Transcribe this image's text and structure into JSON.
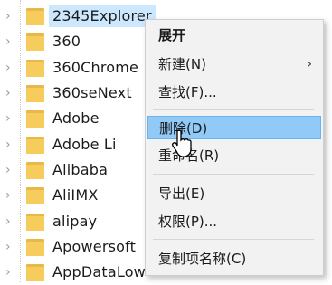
{
  "tree": {
    "items": [
      {
        "label": "2345Explorer",
        "selected": true
      },
      {
        "label": "360"
      },
      {
        "label": "360Chrome"
      },
      {
        "label": "360seNext"
      },
      {
        "label": "Adobe"
      },
      {
        "label": "Adobe Li"
      },
      {
        "label": "Alibaba"
      },
      {
        "label": "AliIMX"
      },
      {
        "label": "alipay"
      },
      {
        "label": "Apowersoft"
      },
      {
        "label": "AppDataLow"
      }
    ],
    "folder_color": "#e8b94a",
    "selected_color": "#cce8ff"
  },
  "context_menu": {
    "items": [
      {
        "label": "展开",
        "bold": true
      },
      {
        "label": "新建(N)",
        "submenu": true,
        "arrow": "›"
      },
      {
        "label": "查找(F)..."
      },
      {
        "label": "删除(D)",
        "highlighted": true
      },
      {
        "label": "重命名(R)"
      },
      {
        "label": "导出(E)"
      },
      {
        "label": "权限(P)..."
      },
      {
        "label": "复制项名称(C)"
      }
    ],
    "highlight_color": "#91c9f7"
  }
}
